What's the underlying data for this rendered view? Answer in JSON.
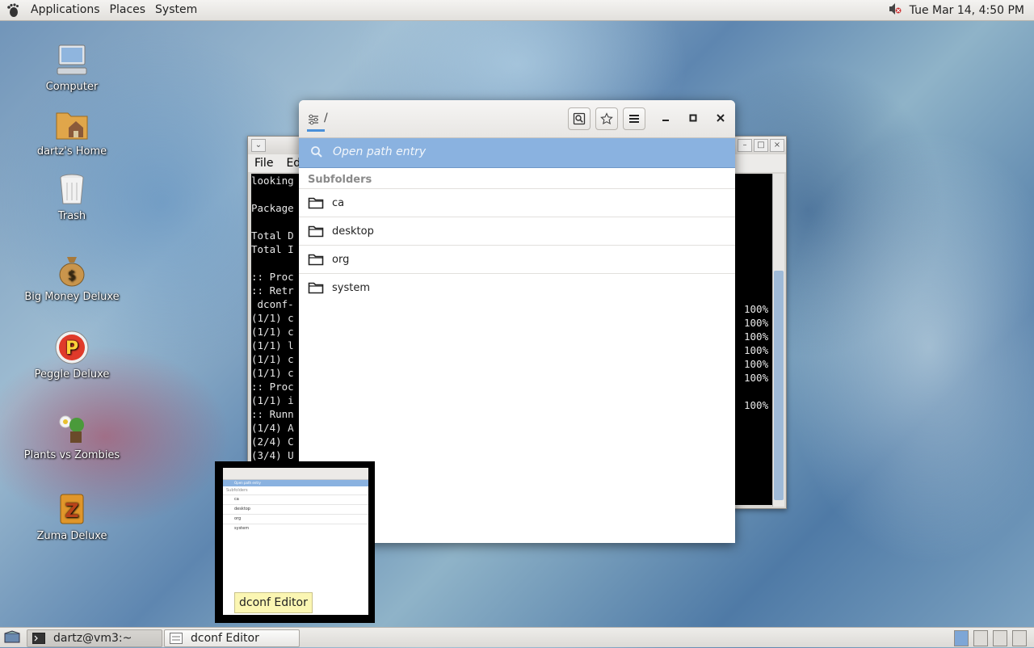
{
  "top_panel": {
    "menus": [
      "Applications",
      "Places",
      "System"
    ],
    "clock": "Tue Mar 14,  4:50 PM"
  },
  "desktop_icons": [
    {
      "label": "Computer"
    },
    {
      "label": "dartz's Home"
    },
    {
      "label": "Trash"
    },
    {
      "label": "Big Money Deluxe"
    },
    {
      "label": "Peggle Deluxe"
    },
    {
      "label": "Plants vs Zombies"
    },
    {
      "label": "Zuma Deluxe"
    }
  ],
  "terminal": {
    "menu": [
      "File",
      "Edi"
    ],
    "lines": [
      "looking",
      "",
      "Package",
      "",
      "Total D",
      "Total I",
      "",
      ":: Proc",
      ":: Retr",
      " dconf-",
      "(1/1) c",
      "(1/1) c",
      "(1/1) l",
      "(1/1) c",
      "(1/1) c",
      ":: Proc",
      "(1/1) i",
      ":: Runn",
      "(1/4) A",
      "(2/4) C",
      "(3/4) U"
    ],
    "percents": [
      "100%",
      "100%",
      "100%",
      "100%",
      "100%",
      "100%",
      "",
      "100%"
    ]
  },
  "dconf": {
    "path": "/",
    "search_placeholder": "Open path entry",
    "section_title": "Subfolders",
    "folders": [
      "ca",
      "desktop",
      "org",
      "system"
    ]
  },
  "preview": {
    "tooltip": "dconf Editor",
    "mini_folders": [
      "ca",
      "desktop",
      "org",
      "system"
    ],
    "mini_section": "Subfolders",
    "mini_search": "Open path entry"
  },
  "taskbar": {
    "tasks": [
      "dartz@vm3:~",
      "dconf Editor"
    ]
  },
  "colors": {
    "accent": "#4a90d9",
    "search_bar": "#8ab2e0",
    "tooltip": "#fbf6b3"
  }
}
